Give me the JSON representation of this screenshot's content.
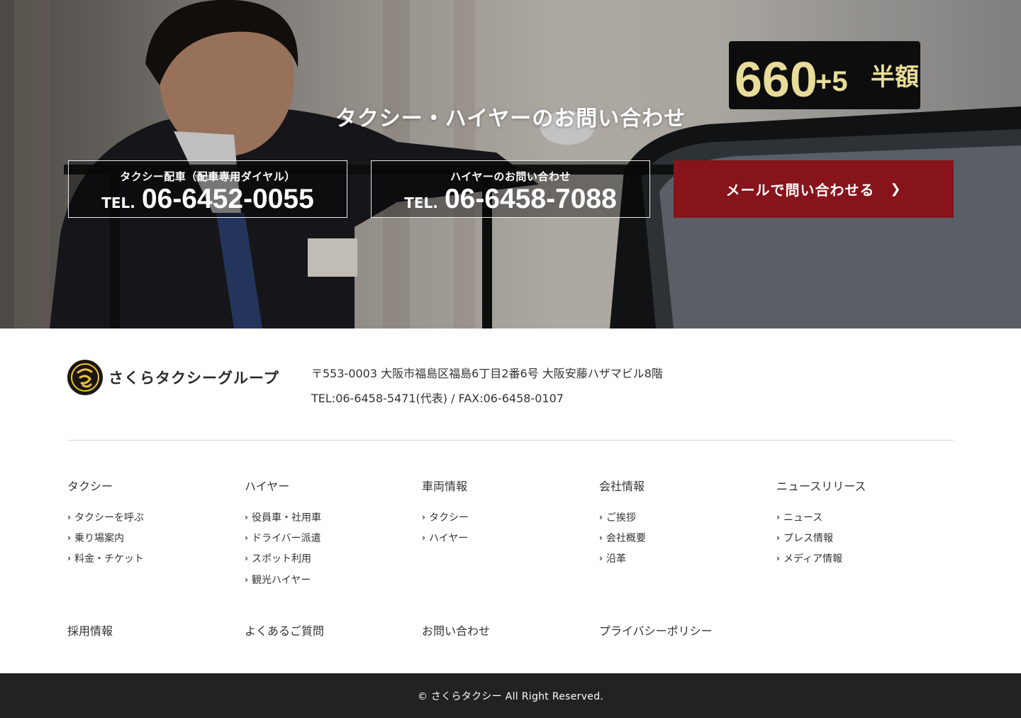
{
  "hero": {
    "title": "タクシー・ハイヤーのお問い合わせ",
    "taxi_tel": {
      "caption": "タクシー配車（配車専用ダイヤル）",
      "prefix": "TEL.",
      "number": "06-6452-0055"
    },
    "hire_tel": {
      "caption": "ハイヤーのお問い合わせ",
      "prefix": "TEL.",
      "number": "06-6458-7088"
    },
    "mail_button": {
      "label": "メールで問い合わせる",
      "icon": "chevron-right-icon"
    },
    "sign_text": "660",
    "sign_text2": "+5",
    "sign_text3": "半額",
    "accent_color": "#86141a"
  },
  "company": {
    "name": "さくらタクシーグループ",
    "address": "〒553-0003 大阪市福島区福島6丁目2番6号 大阪安藤ハザマビル8階",
    "phone_fax": "TEL:06-6458-5471(代表) / FAX:06-6458-0107"
  },
  "nav": {
    "columns": [
      {
        "heading": "タクシー",
        "items": [
          "タクシーを呼ぶ",
          "乗り場案内",
          "料金・チケット"
        ]
      },
      {
        "heading": "ハイヤー",
        "items": [
          "役員車・社用車",
          "ドライバー派遣",
          "スポット利用",
          "観光ハイヤー"
        ]
      },
      {
        "heading": "車両情報",
        "items": [
          "タクシー",
          "ハイヤー"
        ]
      },
      {
        "heading": "会社情報",
        "items": [
          "ご挨拶",
          "会社概要",
          "沿革"
        ]
      },
      {
        "heading": "ニュースリリース",
        "items": [
          "ニュース",
          "プレス情報",
          "メディア情報"
        ]
      }
    ],
    "arrow": "›",
    "bottom_links": [
      "採用情報",
      "よくあるご質問",
      "お問い合わせ",
      "プライバシーポリシー"
    ]
  },
  "footer": {
    "copyright": "© さくらタクシー All Right Reserved.",
    "bar_color": "#222222"
  }
}
